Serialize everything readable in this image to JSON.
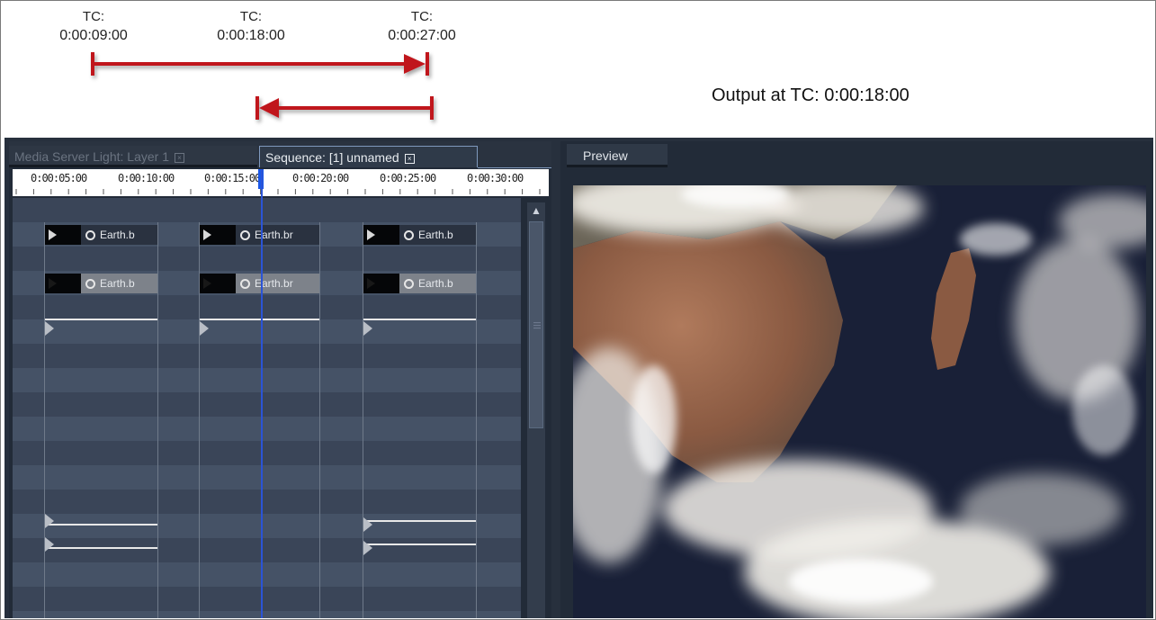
{
  "annotation": {
    "markers": [
      {
        "line1": "TC:",
        "line2": "0:00:09:00"
      },
      {
        "line1": "TC:",
        "line2": "0:00:18:00"
      },
      {
        "line1": "TC:",
        "line2": "0:00:27:00"
      }
    ],
    "output": "Output at TC: 0:00:18:00",
    "arrow_color": "#c0161c"
  },
  "left_panel": {
    "tabs": [
      {
        "label": "Media Server Light: Layer 1",
        "active": false
      },
      {
        "label": "Sequence: [1] unnamed",
        "active": true
      }
    ],
    "ruler_labels": [
      "0:00:05:00",
      "0:00:10:00",
      "0:00:15:00",
      "0:00:20:00",
      "0:00:25:00",
      "0:00:30:00"
    ],
    "clips": {
      "row1": [
        "Earth.b",
        "Earth.br",
        "Earth.b"
      ],
      "row2": [
        "Earth.b",
        "Earth.br",
        "Earth.b"
      ]
    }
  },
  "right_panel": {
    "tab_label": "Preview"
  },
  "colors": {
    "panel_bg": "#222b38",
    "row_dark": "#3a4558",
    "row_light": "#455266",
    "playhead": "#2b54d6",
    "active_tab_border": "#7f99bd"
  }
}
